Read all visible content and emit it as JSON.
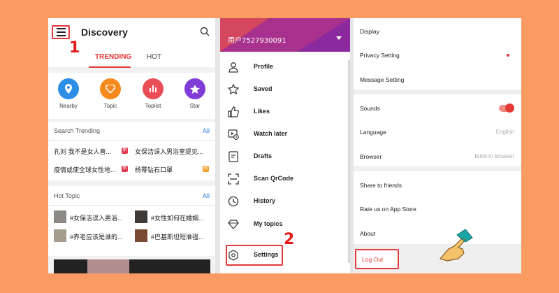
{
  "panel1": {
    "title": "Discovery",
    "step_number": "1",
    "tabs": [
      {
        "label": "TRENDING"
      },
      {
        "label": "HOT"
      }
    ],
    "shortcuts": [
      {
        "label": "Nearby",
        "icon": "location-pin-icon",
        "color": "#2d8ee6"
      },
      {
        "label": "Topic",
        "icon": "diamond-icon",
        "color": "#f58a1e"
      },
      {
        "label": "Toplist",
        "icon": "bar-chart-icon",
        "color": "#ea4d56"
      },
      {
        "label": "Star",
        "icon": "star-icon",
        "color": "#7f3cd6"
      }
    ],
    "search_trending": {
      "header": "Search Trending",
      "all_link": "All",
      "items": [
        {
          "text": "孔刘 我不是女人喜...",
          "tag": "新"
        },
        {
          "text": "女保洁误入男浴室提见..."
        },
        {
          "text": "疫情或使全球女性地...",
          "tag": "新"
        },
        {
          "text": "杨幂钻石口罩",
          "tag": "热"
        }
      ]
    },
    "hot_topic": {
      "header": "Hot Topic",
      "all_link": "All",
      "items": [
        {
          "text": "#女保洁误入男浴..."
        },
        {
          "text": "#女性如何在婚姻..."
        },
        {
          "text": "#养老应该是谁的..."
        },
        {
          "text": "#巴基斯坦短准强..."
        }
      ]
    }
  },
  "panel2": {
    "username": "用户7527930091",
    "step_number": "2",
    "menu": [
      {
        "label": "Profile",
        "icon": "person-icon"
      },
      {
        "label": "Saved",
        "icon": "star-outline-icon"
      },
      {
        "label": "Likes",
        "icon": "thumbs-up-icon"
      },
      {
        "label": "Watch later",
        "icon": "watch-later-icon"
      },
      {
        "label": "Drafts",
        "icon": "drafts-icon"
      },
      {
        "label": "Scan QrCode",
        "icon": "scan-qrcode-icon"
      },
      {
        "label": "History",
        "icon": "clock-icon"
      },
      {
        "label": "My topics",
        "icon": "diamond-outline-icon"
      },
      {
        "label": "Settings",
        "icon": "settings-icon"
      }
    ]
  },
  "panel3": {
    "rows": [
      {
        "label": "Display"
      },
      {
        "label": "Privacy Setting"
      },
      {
        "label": "Message Setting"
      },
      {
        "label": "Sounds"
      },
      {
        "label": "Language",
        "value": "English"
      },
      {
        "label": "Browser",
        "value": "build-in browser"
      },
      {
        "label": "Share to friends"
      },
      {
        "label": "Rate us on App Store"
      },
      {
        "label": "About"
      }
    ],
    "logout_label": "Log Out"
  }
}
